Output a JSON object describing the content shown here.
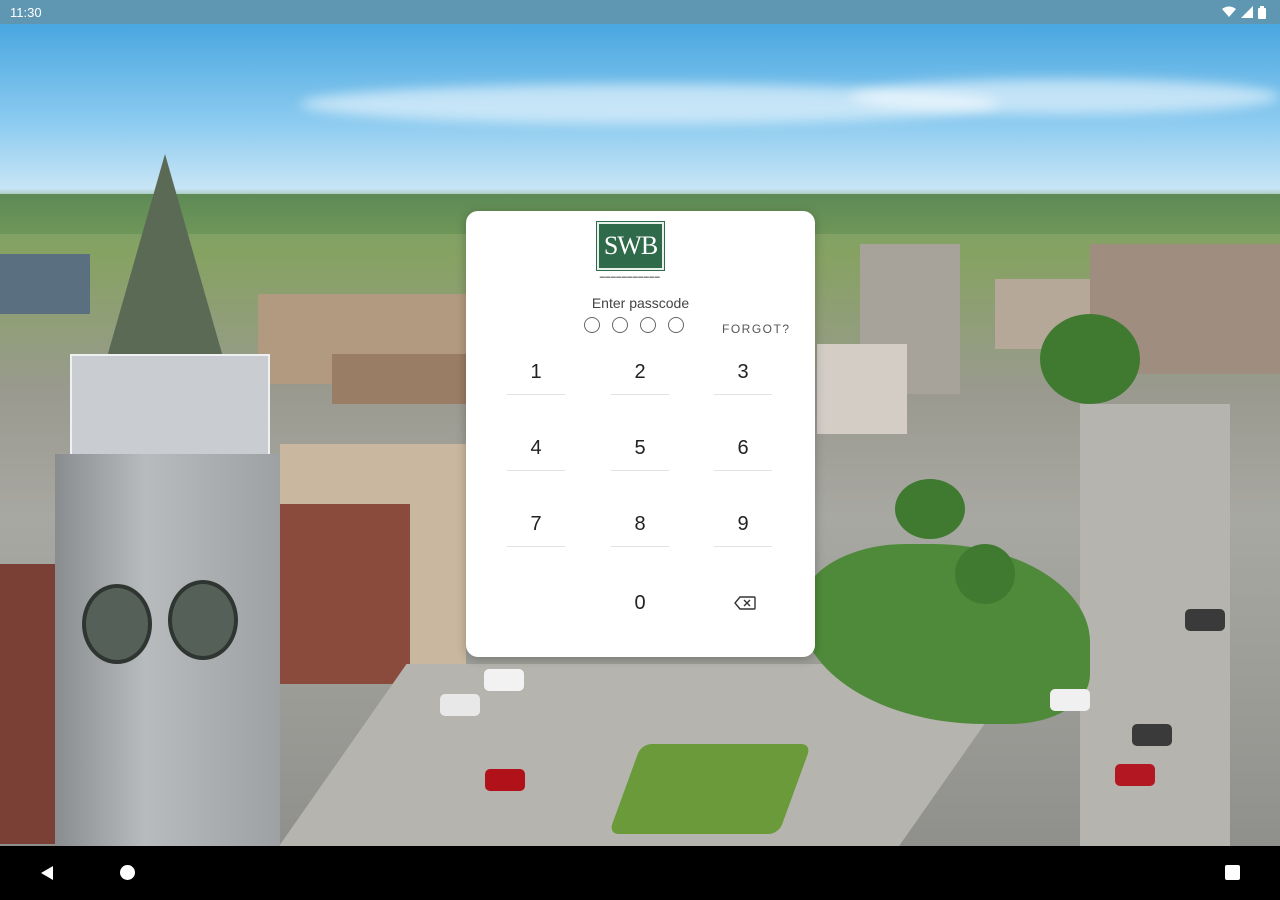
{
  "status_bar": {
    "time": "11:30",
    "icons": [
      "wifi-icon",
      "signal-icon",
      "battery-icon"
    ]
  },
  "lock": {
    "logo_text": "SWB",
    "prompt": "Enter passcode",
    "passcode_length": 4,
    "forgot_label": "FORGOT?",
    "keys": [
      "1",
      "2",
      "3",
      "4",
      "5",
      "6",
      "7",
      "8",
      "9",
      "0"
    ],
    "backspace_icon": "backspace-icon"
  },
  "nav_bar": {
    "buttons": [
      "back-icon",
      "home-icon",
      "recents-icon"
    ]
  },
  "colors": {
    "brand_green": "#2f6a4a",
    "status_bar": "#5f97b3"
  }
}
